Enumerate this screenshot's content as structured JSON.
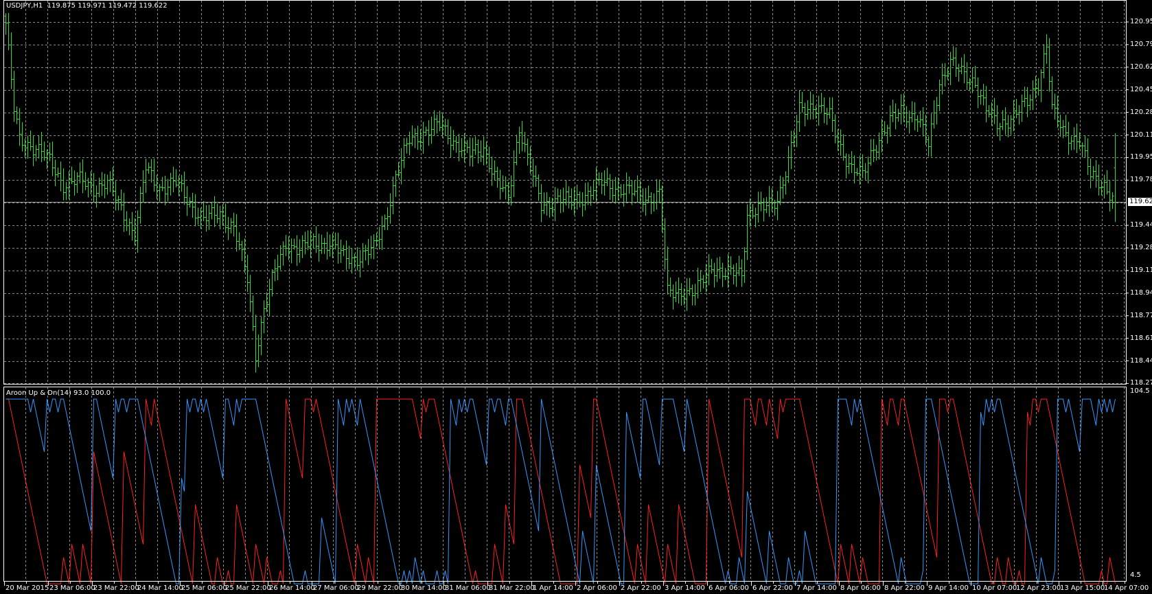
{
  "header": {
    "symbol": "USDJPY,H1",
    "ohlc": "119.875 119.971 119.472 119.622"
  },
  "indicator": {
    "title": "Aroon Up & Dn(14) 93.0 100.0",
    "period": 14,
    "axis_max": "104.5",
    "axis_min": "4.5"
  },
  "price_axis": {
    "labels": [
      "120.955",
      "120.790",
      "120.620",
      "120.450",
      "120.285",
      "120.115",
      "119.950",
      "119.780",
      "119.445",
      "119.280",
      "119.110",
      "118.945",
      "118.775",
      "118.610",
      "118.440",
      "118.275"
    ],
    "current_price": "119.622"
  },
  "time_axis": {
    "labels": [
      "20 Mar 2015",
      "23 Mar 06:00",
      "23 Mar 22:00",
      "24 Mar 14:00",
      "25 Mar 06:00",
      "25 Mar 22:00",
      "26 Mar 14:00",
      "27 Mar 06:00",
      "29 Mar 22:00",
      "30 Mar 14:00",
      "31 Mar 06:00",
      "31 Mar 22:00",
      "1 Apr 14:00",
      "2 Apr 06:00",
      "2 Apr 22:00",
      "3 Apr 14:00",
      "6 Apr 06:00",
      "6 Apr 22:00",
      "7 Apr 14:00",
      "8 Apr 06:00",
      "8 Apr 22:00",
      "9 Apr 14:00",
      "10 Apr 07:00",
      "12 Apr 23:00",
      "13 Apr 15:00",
      "14 Apr 07:00"
    ]
  },
  "colors": {
    "bars": "#33dd33",
    "aroon_up": "#ff2020",
    "aroon_down": "#3399ff",
    "grid": "#8a8a8a",
    "background": "#000000"
  },
  "chart_data": {
    "type": "ohlc",
    "bar_count": 405,
    "close_anchors": [
      [
        0,
        120.95
      ],
      [
        3,
        120.3
      ],
      [
        5,
        120.08
      ],
      [
        11,
        120.03
      ],
      [
        16,
        119.92
      ],
      [
        21,
        119.76
      ],
      [
        27,
        119.78
      ],
      [
        32,
        119.73
      ],
      [
        37,
        119.76
      ],
      [
        43,
        119.54
      ],
      [
        47,
        119.38
      ],
      [
        51,
        119.87
      ],
      [
        56,
        119.73
      ],
      [
        62,
        119.76
      ],
      [
        67,
        119.62
      ],
      [
        72,
        119.49
      ],
      [
        78,
        119.54
      ],
      [
        83,
        119.43
      ],
      [
        88,
        119.05
      ],
      [
        91,
        118.5
      ],
      [
        94,
        118.83
      ],
      [
        98,
        119.1
      ],
      [
        102,
        119.32
      ],
      [
        107,
        119.27
      ],
      [
        112,
        119.32
      ],
      [
        118,
        119.32
      ],
      [
        123,
        119.21
      ],
      [
        128,
        119.21
      ],
      [
        134,
        119.27
      ],
      [
        138,
        119.49
      ],
      [
        142,
        119.81
      ],
      [
        147,
        120.08
      ],
      [
        152,
        120.14
      ],
      [
        158,
        120.19
      ],
      [
        163,
        120.08
      ],
      [
        169,
        119.97
      ],
      [
        174,
        120.03
      ],
      [
        179,
        119.76
      ],
      [
        183,
        119.65
      ],
      [
        187,
        120.19
      ],
      [
        191,
        119.87
      ],
      [
        195,
        119.59
      ],
      [
        201,
        119.65
      ],
      [
        206,
        119.62
      ],
      [
        211,
        119.68
      ],
      [
        217,
        119.76
      ],
      [
        222,
        119.73
      ],
      [
        227,
        119.7
      ],
      [
        233,
        119.65
      ],
      [
        238,
        119.68
      ],
      [
        241,
        118.94
      ],
      [
        246,
        118.97
      ],
      [
        251,
        118.94
      ],
      [
        257,
        119.16
      ],
      [
        262,
        119.08
      ],
      [
        268,
        119.1
      ],
      [
        270,
        119.54
      ],
      [
        276,
        119.57
      ],
      [
        281,
        119.65
      ],
      [
        285,
        119.92
      ],
      [
        289,
        120.3
      ],
      [
        294,
        120.35
      ],
      [
        300,
        120.25
      ],
      [
        304,
        120.03
      ],
      [
        308,
        119.87
      ],
      [
        312,
        119.81
      ],
      [
        316,
        120.03
      ],
      [
        321,
        120.19
      ],
      [
        326,
        120.3
      ],
      [
        332,
        120.25
      ],
      [
        336,
        120.03
      ],
      [
        340,
        120.52
      ],
      [
        344,
        120.66
      ],
      [
        348,
        120.57
      ],
      [
        353,
        120.52
      ],
      [
        357,
        120.3
      ],
      [
        361,
        120.19
      ],
      [
        366,
        120.25
      ],
      [
        372,
        120.35
      ],
      [
        376,
        120.52
      ],
      [
        379,
        120.79
      ],
      [
        381,
        120.3
      ],
      [
        385,
        120.14
      ],
      [
        391,
        120.08
      ],
      [
        395,
        119.81
      ],
      [
        400,
        119.76
      ],
      [
        404,
        119.622
      ]
    ],
    "ylim": [
      118.275,
      120.955
    ],
    "aroon_ylim": [
      4.5,
      104.5
    ]
  }
}
